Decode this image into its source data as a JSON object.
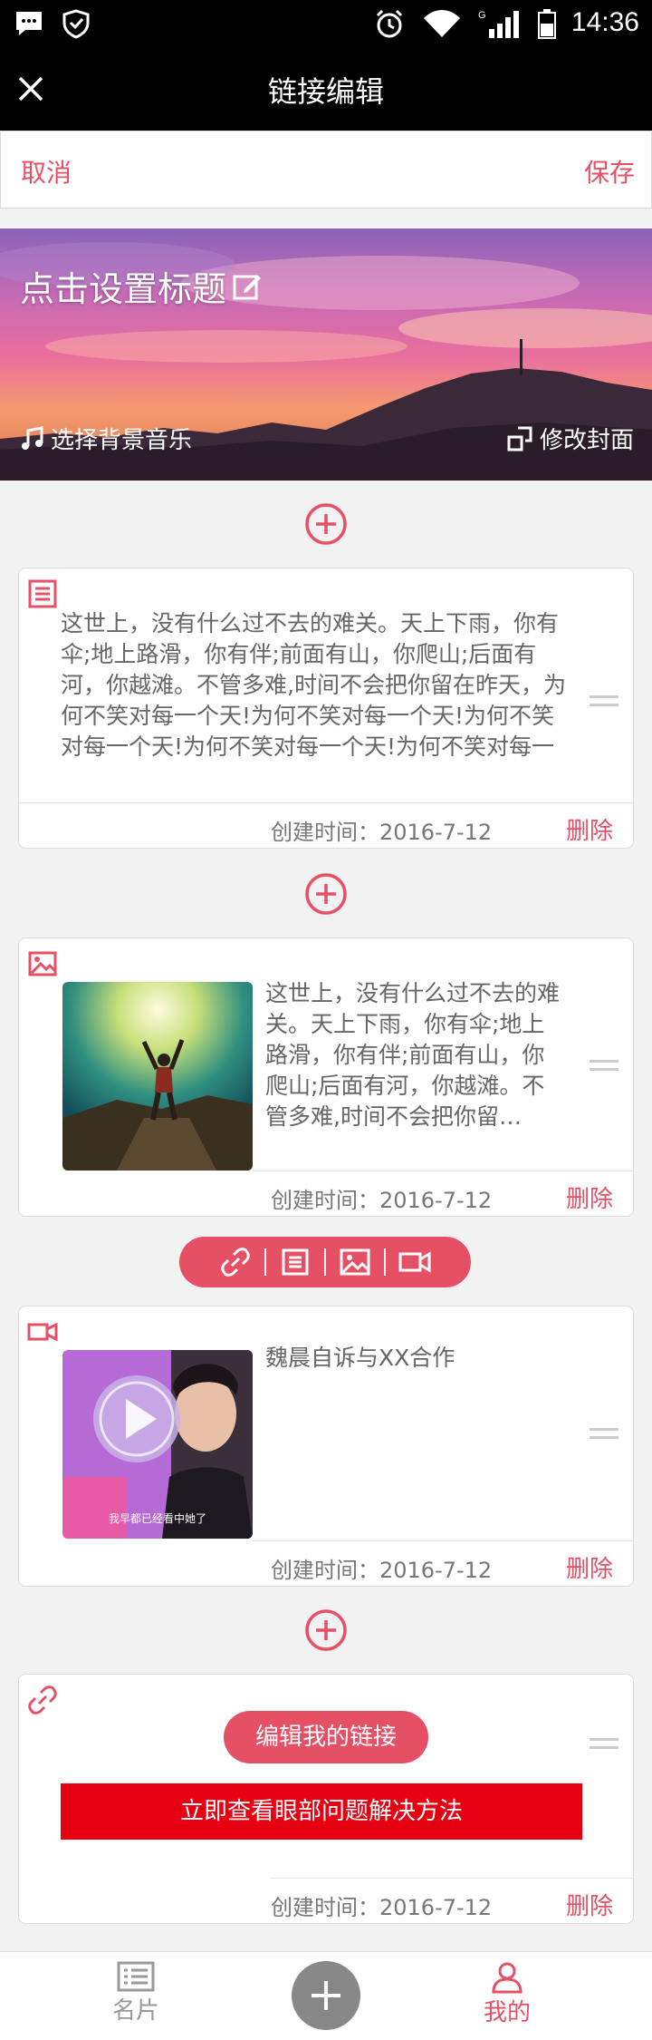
{
  "status_bar": {
    "time": "14:36"
  },
  "title_bar": {
    "title": "链接编辑"
  },
  "action_bar": {
    "cancel_label": "取消",
    "save_label": "保存"
  },
  "cover": {
    "title": "点击设置标题",
    "music_label": "选择背景音乐",
    "change_cover_label": "修改封面"
  },
  "cards": {
    "text_card": {
      "type": "text",
      "content": "这世上，没有什么过不去的难关。天上下雨，你有伞;地上路滑，你有伴;前面有山，你爬山;后面有河，你越滩。不管多难,时间不会把你留在昨天，为何不笑对每一个天!为何不笑对每一个天!为何不笑对每一个天!为何不笑对每一个天!为何不笑对每一个天!…",
      "created": "创建时间：2016-7-12",
      "delete_label": "删除"
    },
    "image_card": {
      "type": "image",
      "content": "这世上，没有什么过不去的难关。天上下雨，你有伞;地上路滑，你有伴;前面有山，你爬山;后面有河，你越滩。不管多难,时间不会把你留…",
      "created": "创建时间：2016-7-12",
      "delete_label": "删除"
    },
    "video_card": {
      "type": "video",
      "title": "魏晨自诉与XX合作",
      "video_caption": "我早都已经看中她了",
      "created": "创建时间：2016-7-12",
      "delete_label": "删除"
    },
    "link_card": {
      "type": "link",
      "edit_label": "编辑我的链接",
      "link_text": "立即查看眼部问题解决方法",
      "created": "创建时间：2016-7-12",
      "delete_label": "删除"
    }
  },
  "insert_toolbar": {
    "items": [
      "link-icon",
      "text-icon",
      "image-icon",
      "video-icon"
    ]
  },
  "bottom_nav": {
    "card_label": "名片",
    "mine_label": "我的"
  },
  "colors": {
    "accent": "#e55065",
    "link_bar": "#e60012",
    "topbar": "#000000"
  }
}
